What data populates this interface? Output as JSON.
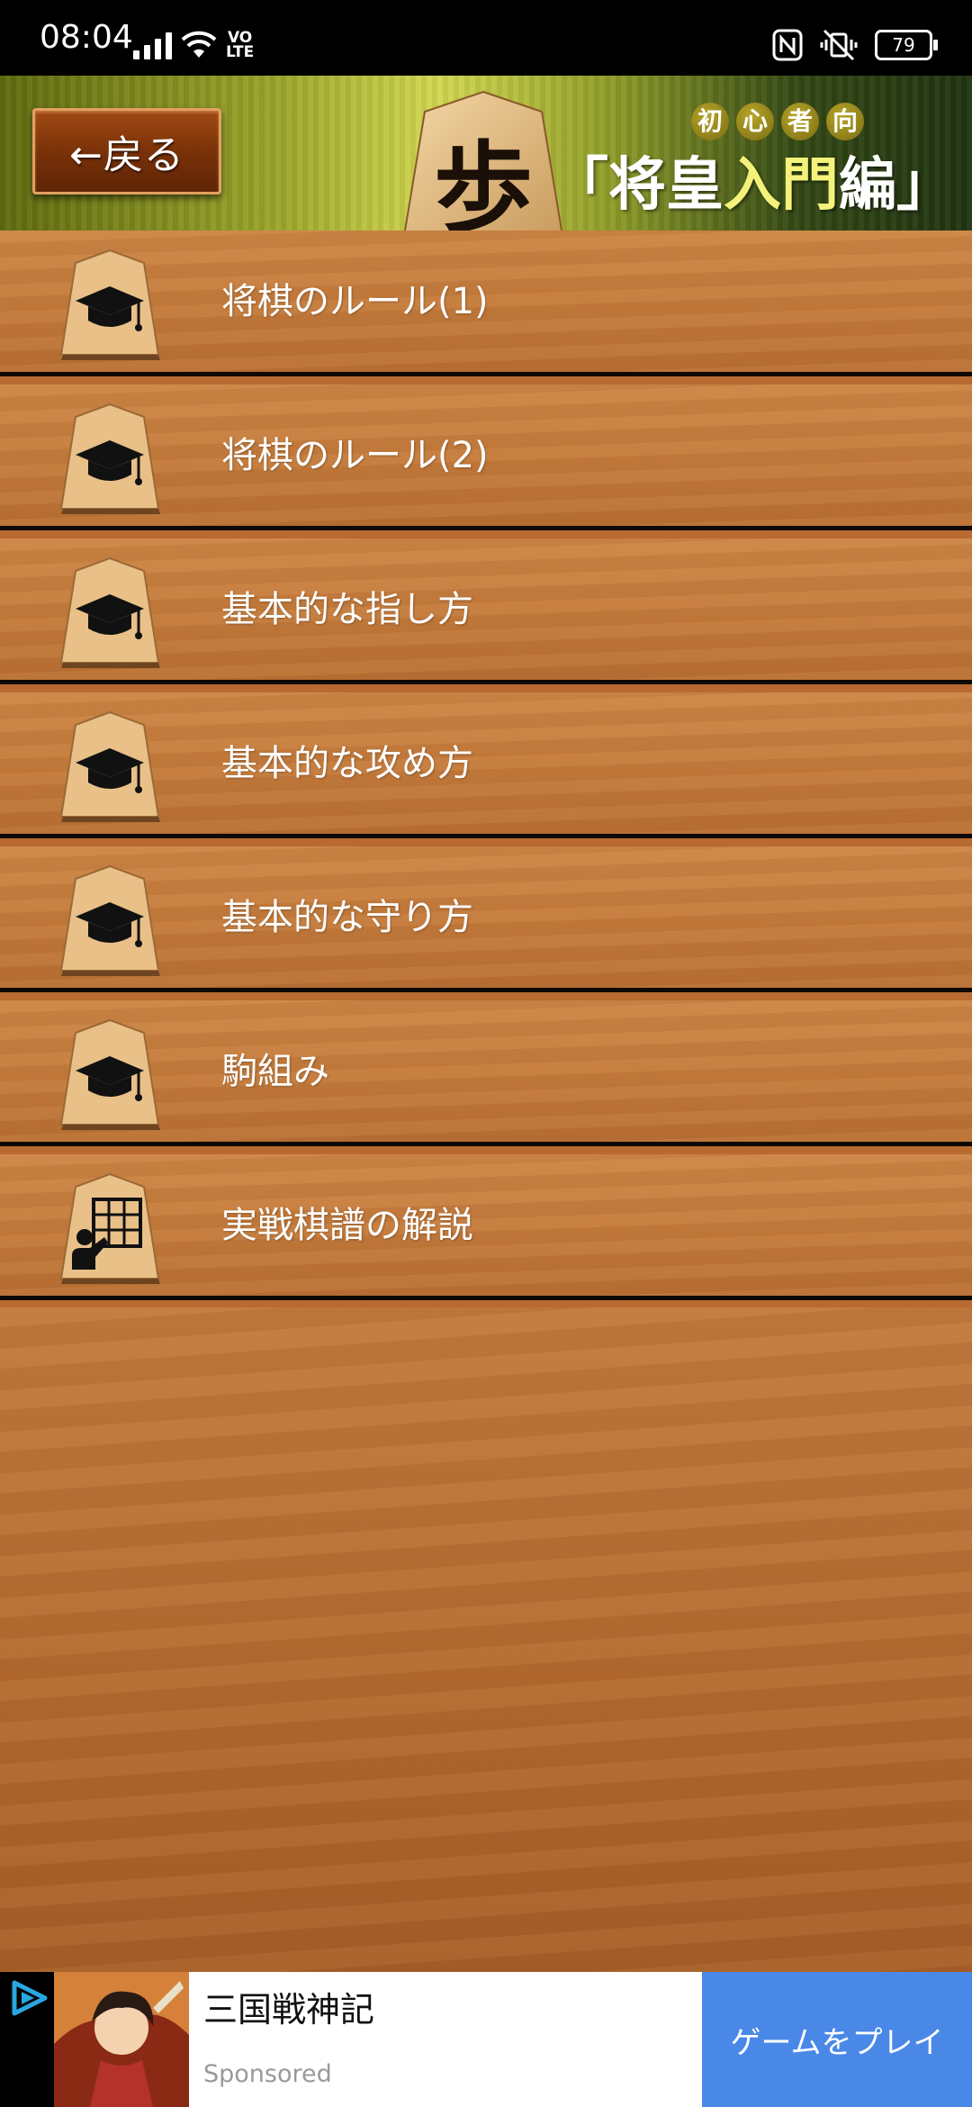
{
  "status_bar": {
    "time": "08:04",
    "network_label": "VO\nLTE",
    "battery_level": "79"
  },
  "header": {
    "back_label": "←戻る",
    "piece_char": "歩",
    "beginner_chars": [
      "初",
      "心",
      "者",
      "向"
    ],
    "title_open": "「将皇",
    "title_highlight": "入門",
    "title_close": "編」"
  },
  "menu": {
    "items": [
      {
        "label": "将棋のルール(1)",
        "icon": "graduation-cap-icon"
      },
      {
        "label": "将棋のルール(2)",
        "icon": "graduation-cap-icon"
      },
      {
        "label": "基本的な指し方",
        "icon": "graduation-cap-icon"
      },
      {
        "label": "基本的な攻め方",
        "icon": "graduation-cap-icon"
      },
      {
        "label": "基本的な守り方",
        "icon": "graduation-cap-icon"
      },
      {
        "label": "駒組み",
        "icon": "graduation-cap-icon"
      },
      {
        "label": "実戦棋譜の解説",
        "icon": "teacher-board-icon"
      }
    ]
  },
  "ad": {
    "title": "三国戦神記",
    "sponsored": "Sponsored",
    "cta_label": "ゲームをプレイ",
    "cta_color": "#4a88e8"
  },
  "colors": {
    "wood": "#c37a3b",
    "divider": "#0e0905",
    "piece": "#e8c088"
  }
}
